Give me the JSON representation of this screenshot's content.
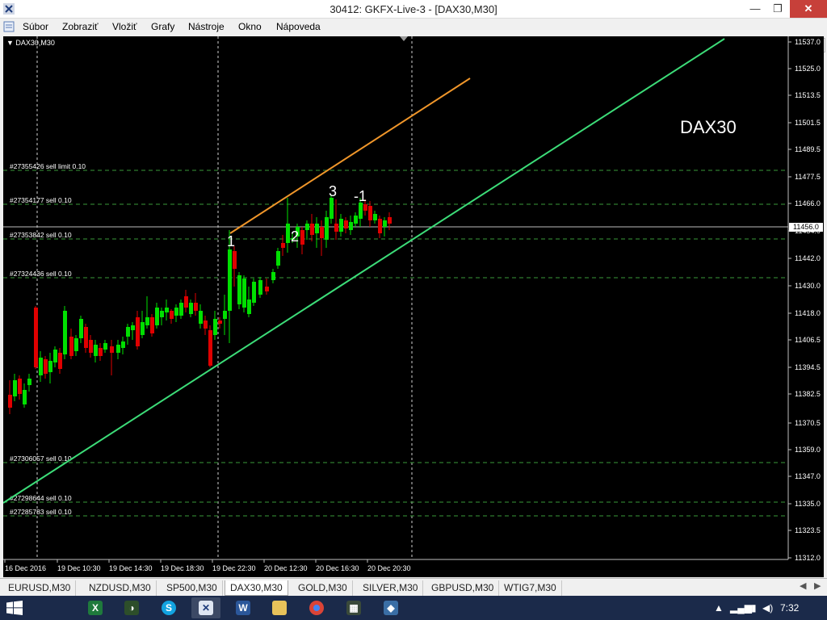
{
  "window": {
    "title": "30412: GKFX-Live-3 - [DAX30,M30]",
    "minimize": "—",
    "maximize": "❐",
    "close": "✕"
  },
  "menu": {
    "items": [
      "Súbor",
      "Zobraziť",
      "Vložiť",
      "Grafy",
      "Nástroje",
      "Okno",
      "Nápoveda"
    ],
    "underline": [
      "S",
      "Z",
      "V",
      "G",
      "N",
      "O",
      "N"
    ]
  },
  "mdi": {
    "minimize": "–",
    "restore": "❐",
    "close": "✕"
  },
  "chart": {
    "label": "▼ DAX30,M30",
    "symbol_text": "DAX30",
    "current_price": "11456.0",
    "price_ticks": [
      "11537.0",
      "11525.0",
      "11513.5",
      "11501.5",
      "11489.5",
      "11477.5",
      "11466.0",
      "11454.0",
      "11442.0",
      "11430.0",
      "11418.0",
      "11406.5",
      "11394.5",
      "11382.5",
      "11370.5",
      "11359.0",
      "11347.0",
      "11335.0",
      "11323.5",
      "11312.0"
    ],
    "time_ticks": [
      "16 Dec 2016",
      "19 Dec 10:30",
      "19 Dec 14:30",
      "19 Dec 18:30",
      "19 Dec 22:30",
      "20 Dec 12:30",
      "20 Dec 16:30",
      "20 Dec 20:30"
    ],
    "orders": [
      {
        "text": "#27355426 sell limit 0.10",
        "price": 11478
      },
      {
        "text": "#27354177 sell 0.10",
        "price": 11466
      },
      {
        "text": "#27353842 sell 0.10",
        "price": 11452
      },
      {
        "text": "#27324436 sell 0.10",
        "price": 11433
      },
      {
        "text": "#27306057 sell 0.10",
        "price": 11352
      },
      {
        "text": "#27298644 sell 0.10",
        "price": 11336
      },
      {
        "text": "#27285783 sell 0.10",
        "price": 11330
      }
    ],
    "wave_labels": [
      "1",
      "2",
      "3",
      "-1"
    ],
    "colors": {
      "background": "#000000",
      "bull": "#00e000",
      "bear": "#e00000",
      "trendline": "#3cdc78",
      "channel": "#f0962a",
      "order_line": "#3a9a3a",
      "grid": "#d0d0d0"
    }
  },
  "tabs": {
    "items": [
      "EURUSD,M30",
      "NZDUSD,M30",
      "SP500,M30",
      "DAX30,M30",
      "GOLD,M30",
      "SILVER,M30",
      "GBPUSD,M30",
      "WTIG7,M30"
    ],
    "active": "DAX30,M30"
  },
  "taskbar": {
    "time": "7:32",
    "apps": [
      "excel-icon",
      "metatrader-icon",
      "skype-icon",
      "metatrader-active-icon",
      "word-icon",
      "file-explorer-icon",
      "chrome-icon",
      "metatrader2-icon",
      "metatrader3-icon"
    ]
  }
}
